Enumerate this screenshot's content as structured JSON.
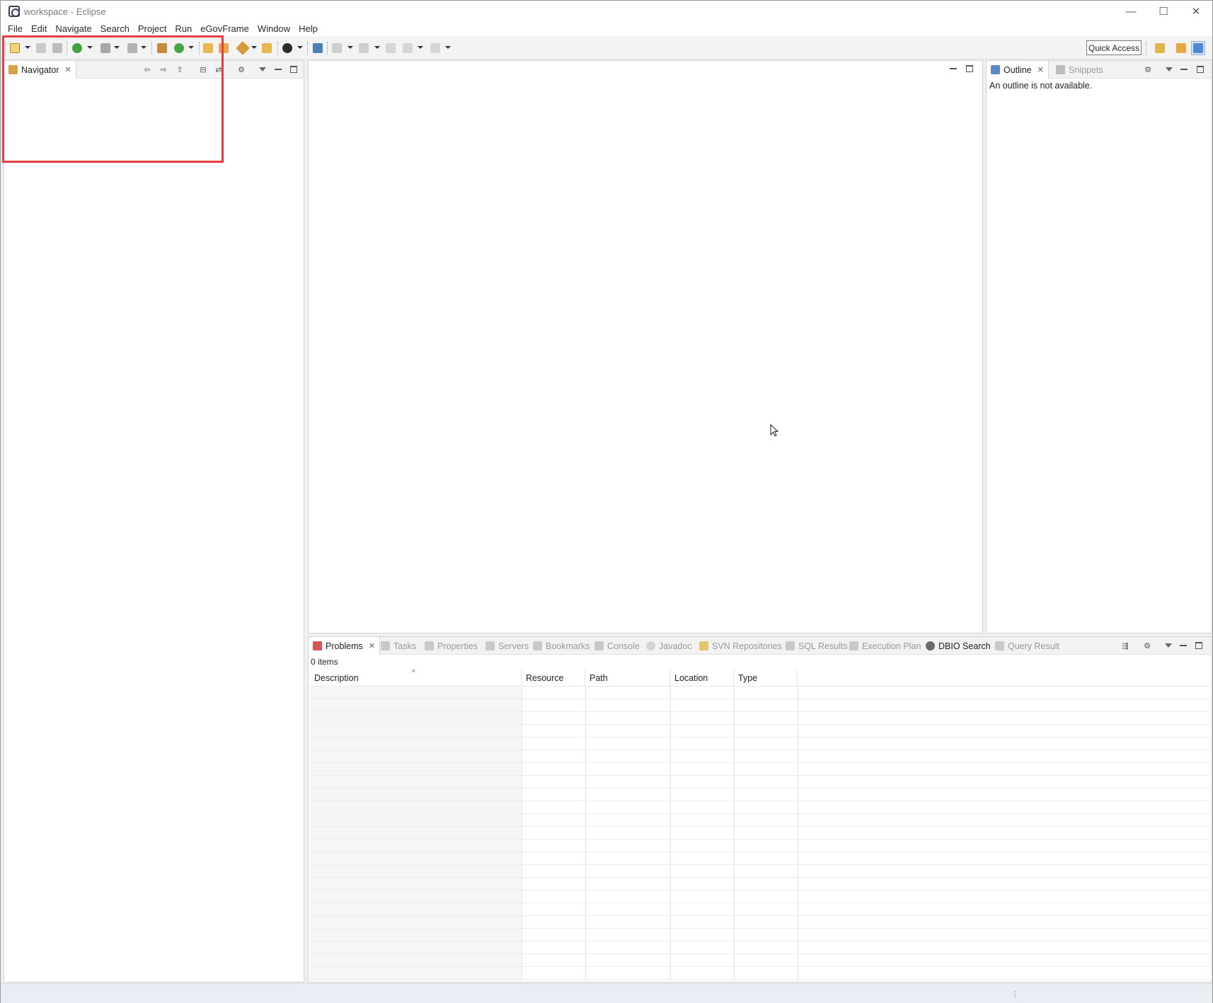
{
  "window": {
    "title": "workspace - Eclipse",
    "controls": {
      "minimize": "—",
      "maximize": "☐",
      "close": "✕"
    }
  },
  "menubar": {
    "items": [
      "File",
      "Edit",
      "Navigate",
      "Search",
      "Project",
      "Run",
      "eGovFrame",
      "Window",
      "Help"
    ]
  },
  "toolbar": {
    "quick_access_label": "Quick Access"
  },
  "navigator": {
    "tab_label": "Navigator",
    "close": "✕"
  },
  "outline": {
    "tabs": [
      {
        "label": "Outline",
        "close": "✕"
      },
      {
        "label": "Snippets"
      }
    ],
    "message": "An outline is not available."
  },
  "bottom_panel": {
    "tabs": [
      {
        "label": "Problems",
        "close": "✕"
      },
      {
        "label": "Tasks"
      },
      {
        "label": "Properties"
      },
      {
        "label": "Servers"
      },
      {
        "label": "Bookmarks"
      },
      {
        "label": "Console"
      },
      {
        "label": "Javadoc"
      },
      {
        "label": "SVN Repositories"
      },
      {
        "label": "SQL Results"
      },
      {
        "label": "Execution Plan"
      },
      {
        "label": "DBIO Search"
      },
      {
        "label": "Query Result"
      }
    ],
    "items_count": "0 items",
    "columns": [
      "Description",
      "Resource",
      "Path",
      "Location",
      "Type"
    ],
    "sort_indicator": "^"
  },
  "status": {
    "grip": "⋮"
  },
  "colors": {
    "highlight": "#e53f46",
    "status_bar": "#e8eef4"
  }
}
